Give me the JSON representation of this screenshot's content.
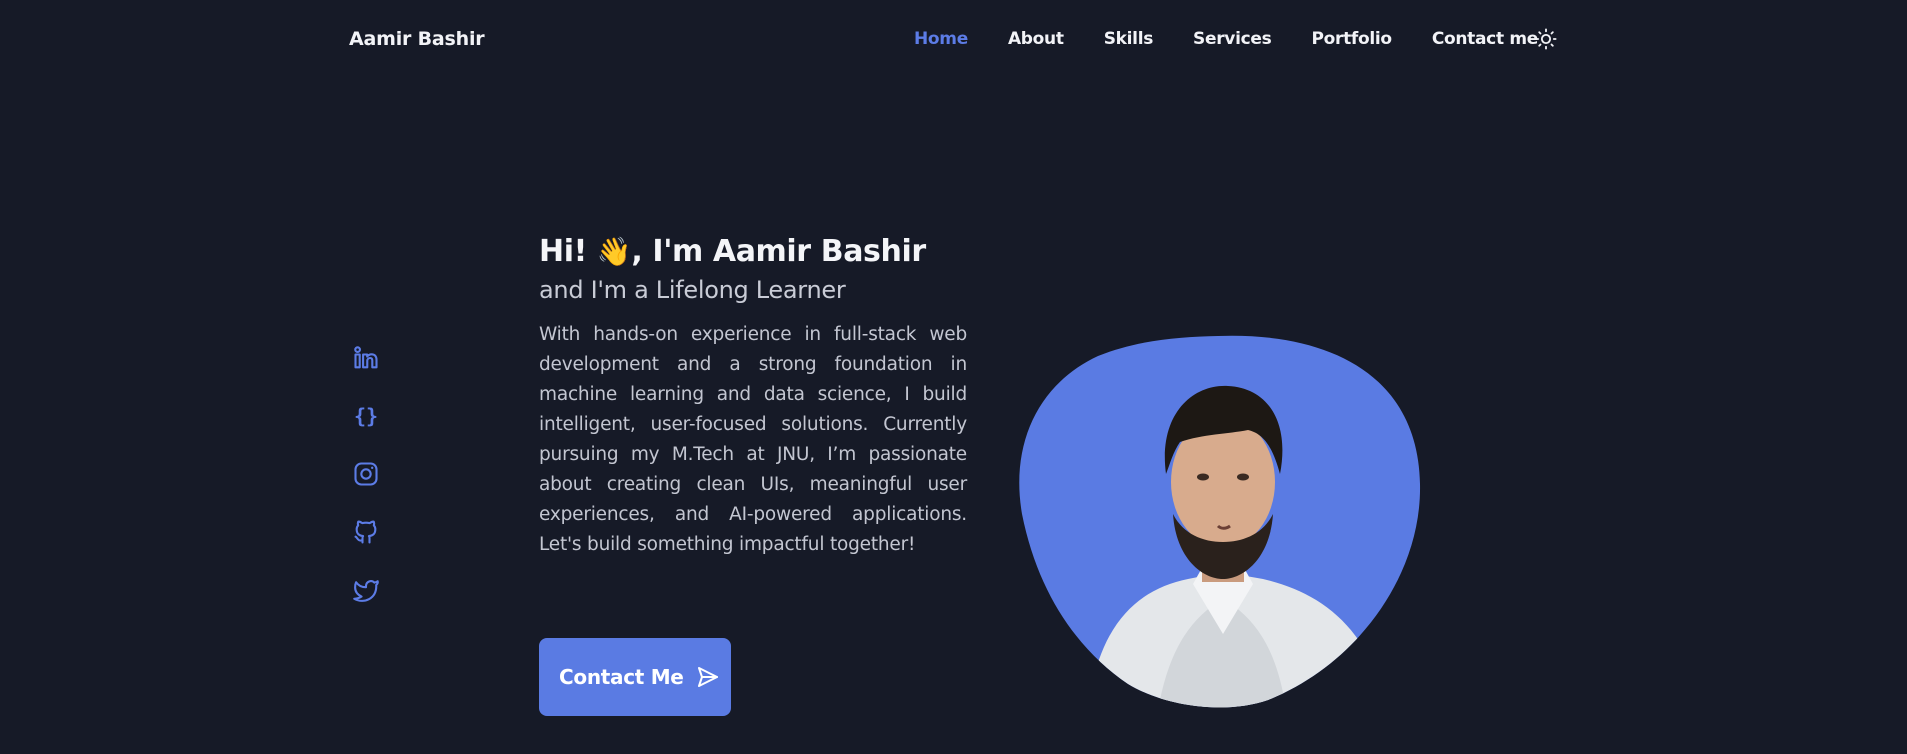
{
  "header": {
    "logo": "Aamir Bashir",
    "nav": [
      {
        "label": "Home",
        "active": true
      },
      {
        "label": "About",
        "active": false
      },
      {
        "label": "Skills",
        "active": false
      },
      {
        "label": "Services",
        "active": false
      },
      {
        "label": "Portfolio",
        "active": false
      },
      {
        "label": "Contact me",
        "active": false
      }
    ],
    "theme_toggle_icon": "sun-icon"
  },
  "social": {
    "icons": [
      "linkedin-icon",
      "braces-icon",
      "instagram-icon",
      "github-icon",
      "twitter-icon"
    ],
    "braces_glyph": "{}"
  },
  "hero": {
    "greeting_prefix": "Hi!",
    "wave_emoji": "👋",
    "greeting_suffix": ", I'm Aamir Bashir",
    "subtitle": "and I'm a Lifelong Learner",
    "description": "With hands-on experience in full-stack web development and a strong foundation in machine learning and data science, I build intelligent, user-focused solutions. Currently pursuing my M.Tech at JNU, I’m passionate about creating clean UIs, meaningful user experiences, and AI-powered applications. Let's build something impactful together!",
    "cta_label": "Contact Me",
    "cta_icon": "send-icon"
  },
  "colors": {
    "background": "#161a27",
    "accent": "#5c7ce6",
    "text": "#f2f3f7"
  }
}
